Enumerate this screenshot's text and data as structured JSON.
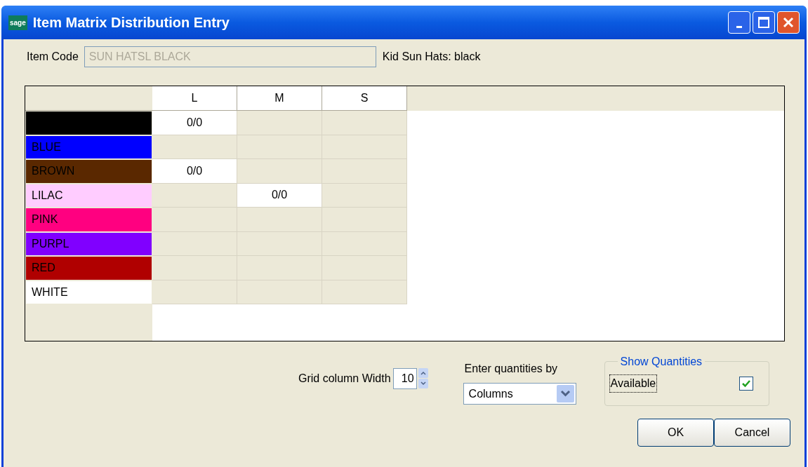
{
  "window": {
    "title": "Item Matrix Distribution Entry",
    "logo": "sage"
  },
  "item_code": {
    "label": "Item Code",
    "value": "SUN HATSL BLACK",
    "disabled": true,
    "description": "Kid Sun Hats: black"
  },
  "grid": {
    "columns": [
      "L",
      "M",
      "S"
    ],
    "rows": [
      {
        "label": "",
        "color": "#000000",
        "cells": [
          {
            "value": "0/0",
            "enabled": true
          },
          {
            "enabled": false
          },
          {
            "enabled": false
          }
        ]
      },
      {
        "label": "BLUE",
        "color": "#0000ff",
        "cells": [
          {
            "enabled": false
          },
          {
            "enabled": false
          },
          {
            "enabled": false
          }
        ]
      },
      {
        "label": "BROWN",
        "color": "#5a2800",
        "cells": [
          {
            "value": "0/0",
            "enabled": true
          },
          {
            "enabled": false
          },
          {
            "enabled": false
          }
        ]
      },
      {
        "label": "LILAC",
        "color": "#ffccff",
        "cells": [
          {
            "enabled": false
          },
          {
            "value": "0/0",
            "enabled": true
          },
          {
            "enabled": false
          }
        ]
      },
      {
        "label": "PINK",
        "color": "#ff0080",
        "cells": [
          {
            "enabled": false
          },
          {
            "enabled": false
          },
          {
            "enabled": false
          }
        ]
      },
      {
        "label": "PURPL",
        "color": "#8000ff",
        "cells": [
          {
            "enabled": false
          },
          {
            "enabled": false
          },
          {
            "enabled": false
          }
        ]
      },
      {
        "label": "RED",
        "color": "#b00000",
        "cells": [
          {
            "enabled": false
          },
          {
            "enabled": false
          },
          {
            "enabled": false
          }
        ]
      },
      {
        "label": "WHITE",
        "color": "#ffffff",
        "cells": [
          {
            "enabled": false
          },
          {
            "enabled": false
          },
          {
            "enabled": false
          }
        ]
      }
    ]
  },
  "column_width": {
    "label": "Grid column Width",
    "value": "10"
  },
  "enter_by": {
    "label": "Enter quantities by",
    "value": "Columns"
  },
  "show_quantities": {
    "title": "Show Quantities",
    "label": "Available",
    "checked": true
  },
  "buttons": [
    "OK",
    "Cancel"
  ]
}
